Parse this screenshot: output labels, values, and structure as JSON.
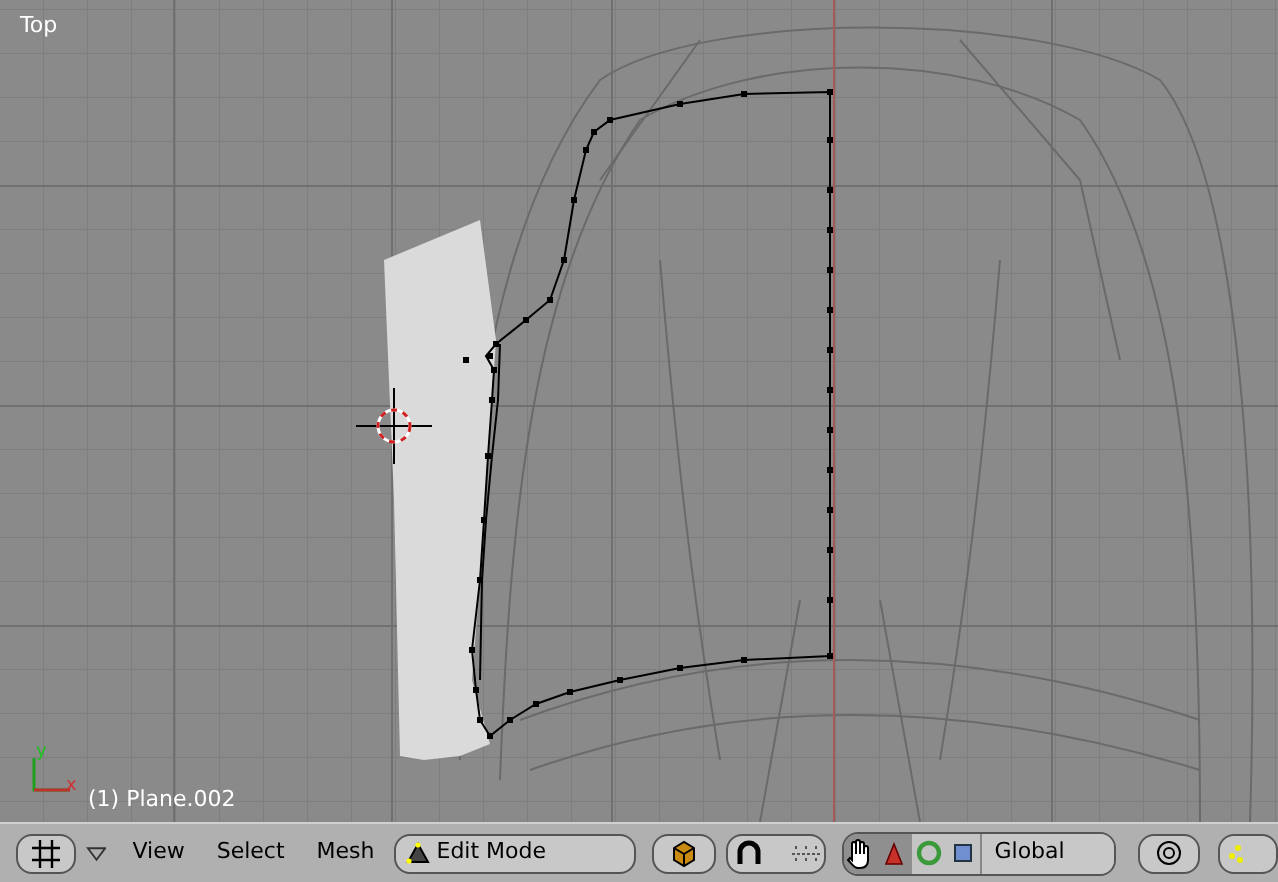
{
  "viewport": {
    "view_name": "Top",
    "object_label": "(1) Plane.002",
    "axes": {
      "x": "x",
      "y": "y"
    }
  },
  "header": {
    "menus": [
      "View",
      "Select",
      "Mesh"
    ],
    "mode": "Edit Mode",
    "manipulators": [
      {
        "kind": "hand",
        "selected": true
      },
      {
        "kind": "translate",
        "selected": true
      },
      {
        "kind": "rotate",
        "selected": false
      },
      {
        "kind": "scale",
        "selected": false
      }
    ],
    "orientation": "Global"
  }
}
